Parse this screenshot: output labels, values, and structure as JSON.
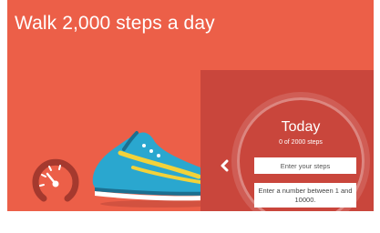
{
  "header": {
    "title": "Walk 2,000 steps a day"
  },
  "tracker": {
    "heading": "Today",
    "progress_text": "0 of 2000 steps",
    "input_placeholder": "Enter your steps",
    "validation_message": "Enter a number between 1 and 10000."
  },
  "icons": {
    "previous": "chevron-left-icon",
    "next": "chevron-right-icon",
    "speedometer": "speedometer-icon",
    "sneaker": "sneaker-icon"
  },
  "colors": {
    "background": "#ec5f48",
    "panel": "#c9463c",
    "shoe_primary": "#2aa7cf",
    "shoe_accent": "#f2d23a"
  }
}
